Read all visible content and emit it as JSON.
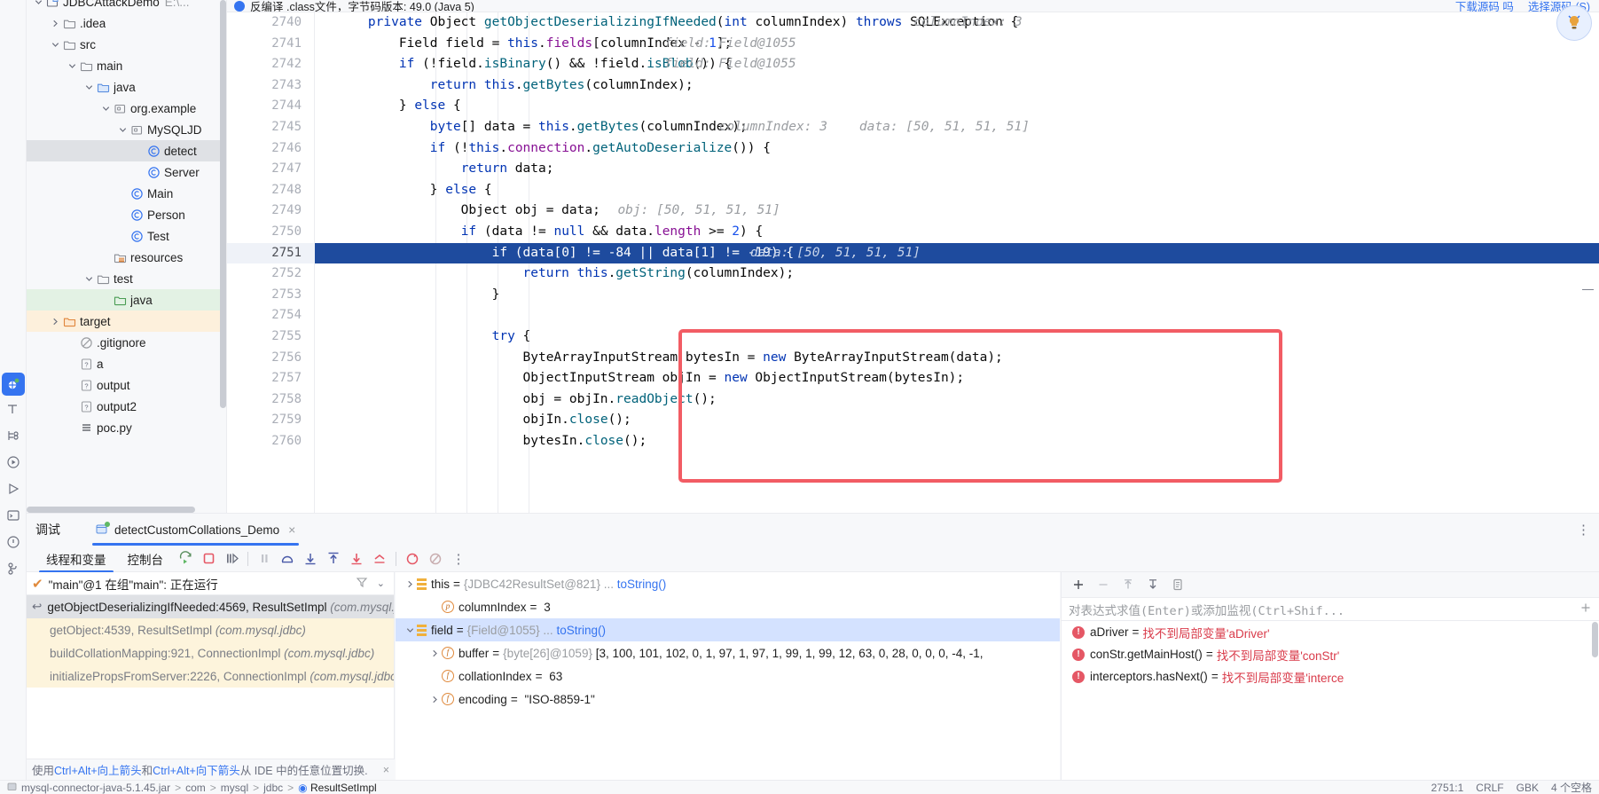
{
  "notification": {
    "text": "反编译 .class文件，字节码版本: 49.0 (Java 5)",
    "actions": [
      "下载源码 吗",
      "选择源码 (S)"
    ]
  },
  "activity_bar": {
    "items": [
      {
        "name": "debug-icon",
        "label": "Debug"
      },
      {
        "name": "build-icon",
        "label": "Build"
      },
      {
        "name": "structure-icon",
        "label": "Structure"
      },
      {
        "name": "run-icon",
        "label": "Run"
      },
      {
        "name": "play-icon",
        "label": "Run Configuration"
      },
      {
        "name": "terminal-icon",
        "label": "Terminal"
      },
      {
        "name": "problems-icon",
        "label": "Problems"
      },
      {
        "name": "git-icon",
        "label": "Git"
      }
    ]
  },
  "project_tree": {
    "items": [
      {
        "label": "JDBCAttackDemo",
        "suffix": "E:\\...",
        "indent": 0,
        "chev": "down",
        "icon": "module-icon",
        "state": "clipped"
      },
      {
        "label": ".idea",
        "indent": 1,
        "chev": "right",
        "icon": "folder-icon"
      },
      {
        "label": "src",
        "indent": 1,
        "chev": "down",
        "icon": "folder-icon"
      },
      {
        "label": "main",
        "indent": 2,
        "chev": "down",
        "icon": "folder-icon"
      },
      {
        "label": "java",
        "indent": 3,
        "chev": "down",
        "icon": "source-folder-icon"
      },
      {
        "label": "org.example",
        "indent": 4,
        "chev": "down",
        "icon": "package-icon"
      },
      {
        "label": "MySQLJD",
        "indent": 5,
        "chev": "down",
        "icon": "package-icon"
      },
      {
        "label": "detect",
        "indent": 6,
        "chev": "none",
        "icon": "class-icon",
        "state": "selected"
      },
      {
        "label": "Server",
        "indent": 6,
        "chev": "none",
        "icon": "class-icon"
      },
      {
        "label": "Main",
        "indent": 5,
        "chev": "none",
        "icon": "class-icon"
      },
      {
        "label": "Person",
        "indent": 5,
        "chev": "none",
        "icon": "class-icon"
      },
      {
        "label": "Test",
        "indent": 5,
        "chev": "none",
        "icon": "class-icon"
      },
      {
        "label": "resources",
        "indent": 4,
        "chev": "none",
        "icon": "resources-folder-icon"
      },
      {
        "label": "test",
        "indent": 3,
        "chev": "down",
        "icon": "folder-icon"
      },
      {
        "label": "java",
        "indent": 4,
        "chev": "none",
        "icon": "test-source-folder-icon",
        "state": "green"
      },
      {
        "label": "target",
        "indent": 1,
        "chev": "right",
        "icon": "excluded-folder-icon",
        "state": "orange"
      },
      {
        "label": ".gitignore",
        "indent": 2,
        "chev": "none",
        "icon": "gitignore-icon"
      },
      {
        "label": "a",
        "indent": 2,
        "chev": "none",
        "icon": "unknown-file-icon"
      },
      {
        "label": "output",
        "indent": 2,
        "chev": "none",
        "icon": "unknown-file-icon"
      },
      {
        "label": "output2",
        "indent": 2,
        "chev": "none",
        "icon": "unknown-file-icon"
      },
      {
        "label": "poc.py",
        "indent": 2,
        "chev": "none",
        "icon": "python-file-icon"
      }
    ]
  },
  "editor": {
    "lines": [
      {
        "n": 2740,
        "tokens": [
          {
            "t": "    ",
            "c": "plain"
          },
          {
            "t": "private",
            "c": "kw"
          },
          {
            "t": " ",
            "c": "plain"
          },
          {
            "t": "Object",
            "c": "plain"
          },
          {
            "t": " ",
            "c": "plain"
          },
          {
            "t": "getObjectDeserializingIfNeeded",
            "c": "mth"
          },
          {
            "t": "(",
            "c": "plain"
          },
          {
            "t": "int",
            "c": "kw"
          },
          {
            "t": " columnIndex) ",
            "c": "plain"
          },
          {
            "t": "throws",
            "c": "kw"
          },
          {
            "t": " SQLException {",
            "c": "plain"
          }
        ],
        "hints": [
          {
            "t": "columnIndex: 3",
            "col": 74
          }
        ]
      },
      {
        "n": 2741,
        "tokens": [
          {
            "t": "        Field field = ",
            "c": "plain"
          },
          {
            "t": "this",
            "c": "kw"
          },
          {
            "t": ".",
            "c": "plain"
          },
          {
            "t": "fields",
            "c": "fld"
          },
          {
            "t": "[columnIndex - ",
            "c": "plain"
          },
          {
            "t": "1",
            "c": "num"
          },
          {
            "t": "];",
            "c": "plain"
          }
        ],
        "hints": [
          {
            "t": "field: Field@1055",
            "col": 42
          }
        ]
      },
      {
        "n": 2742,
        "tokens": [
          {
            "t": "        ",
            "c": "plain"
          },
          {
            "t": "if",
            "c": "kw"
          },
          {
            "t": " (!field.",
            "c": "plain"
          },
          {
            "t": "isBinary",
            "c": "mth"
          },
          {
            "t": "() && !field.",
            "c": "plain"
          },
          {
            "t": "isBlob",
            "c": "mth"
          },
          {
            "t": "()) {",
            "c": "plain"
          }
        ],
        "hints": [
          {
            "t": "field: Field@1055",
            "col": 42
          }
        ]
      },
      {
        "n": 2743,
        "tokens": [
          {
            "t": "            ",
            "c": "plain"
          },
          {
            "t": "return",
            "c": "kw"
          },
          {
            "t": " ",
            "c": "plain"
          },
          {
            "t": "this",
            "c": "kw"
          },
          {
            "t": ".",
            "c": "plain"
          },
          {
            "t": "getBytes",
            "c": "mth"
          },
          {
            "t": "(columnIndex);",
            "c": "plain"
          }
        ],
        "hints": []
      },
      {
        "n": 2744,
        "tokens": [
          {
            "t": "        } ",
            "c": "plain"
          },
          {
            "t": "else",
            "c": "kw"
          },
          {
            "t": " {",
            "c": "plain"
          }
        ],
        "hints": []
      },
      {
        "n": 2745,
        "tokens": [
          {
            "t": "            ",
            "c": "plain"
          },
          {
            "t": "byte",
            "c": "kw"
          },
          {
            "t": "[] data = ",
            "c": "plain"
          },
          {
            "t": "this",
            "c": "kw"
          },
          {
            "t": ".",
            "c": "plain"
          },
          {
            "t": "getBytes",
            "c": "mth"
          },
          {
            "t": "(columnIndex);",
            "c": "plain"
          }
        ],
        "hints": [
          {
            "t": "columnIndex: 3",
            "col": 49
          },
          {
            "t": "data: [50, 51, 51, 51]",
            "col": 67
          }
        ]
      },
      {
        "n": 2746,
        "tokens": [
          {
            "t": "            ",
            "c": "plain"
          },
          {
            "t": "if",
            "c": "kw"
          },
          {
            "t": " (!",
            "c": "plain"
          },
          {
            "t": "this",
            "c": "kw"
          },
          {
            "t": ".",
            "c": "plain"
          },
          {
            "t": "connection",
            "c": "fld"
          },
          {
            "t": ".",
            "c": "plain"
          },
          {
            "t": "getAutoDeserialize",
            "c": "mth"
          },
          {
            "t": "()) {",
            "c": "plain"
          }
        ],
        "hints": []
      },
      {
        "n": 2747,
        "tokens": [
          {
            "t": "                ",
            "c": "plain"
          },
          {
            "t": "return",
            "c": "kw"
          },
          {
            "t": " data;",
            "c": "plain"
          }
        ],
        "hints": []
      },
      {
        "n": 2748,
        "tokens": [
          {
            "t": "            } ",
            "c": "plain"
          },
          {
            "t": "else",
            "c": "kw"
          },
          {
            "t": " {",
            "c": "plain"
          }
        ],
        "hints": []
      },
      {
        "n": 2749,
        "tokens": [
          {
            "t": "                Object obj = data;",
            "c": "plain"
          }
        ],
        "hints": [
          {
            "t": "obj: [50, 51, 51, 51]",
            "col": 36
          }
        ]
      },
      {
        "n": 2750,
        "tokens": [
          {
            "t": "                ",
            "c": "plain"
          },
          {
            "t": "if",
            "c": "kw"
          },
          {
            "t": " (data != ",
            "c": "plain"
          },
          {
            "t": "null",
            "c": "kw"
          },
          {
            "t": " && data.",
            "c": "plain"
          },
          {
            "t": "length",
            "c": "fld"
          },
          {
            "t": " >= ",
            "c": "plain"
          },
          {
            "t": "2",
            "c": "num"
          },
          {
            "t": ") {",
            "c": "plain"
          }
        ],
        "hints": []
      },
      {
        "n": 2751,
        "tokens": [
          {
            "t": "                    ",
            "c": "plain"
          },
          {
            "t": "if",
            "c": "kw"
          },
          {
            "t": " (data[",
            "c": "plain"
          },
          {
            "t": "0",
            "c": "num"
          },
          {
            "t": "] != -",
            "c": "plain"
          },
          {
            "t": "84",
            "c": "num"
          },
          {
            "t": " || data[",
            "c": "plain"
          },
          {
            "t": "1",
            "c": "num"
          },
          {
            "t": "] != -",
            "c": "plain"
          },
          {
            "t": "19",
            "c": "num"
          },
          {
            "t": ") {",
            "c": "plain"
          }
        ],
        "hints": [
          {
            "t": "data: [50, 51, 51, 51]",
            "col": 53
          }
        ],
        "highlight": true
      },
      {
        "n": 2752,
        "tokens": [
          {
            "t": "                        ",
            "c": "plain"
          },
          {
            "t": "return",
            "c": "kw"
          },
          {
            "t": " ",
            "c": "plain"
          },
          {
            "t": "this",
            "c": "kw"
          },
          {
            "t": ".",
            "c": "plain"
          },
          {
            "t": "getString",
            "c": "mth"
          },
          {
            "t": "(columnIndex);",
            "c": "plain"
          }
        ],
        "hints": []
      },
      {
        "n": 2753,
        "tokens": [
          {
            "t": "                    }",
            "c": "plain"
          }
        ],
        "hints": []
      },
      {
        "n": 2754,
        "tokens": [],
        "hints": []
      },
      {
        "n": 2755,
        "tokens": [
          {
            "t": "                    ",
            "c": "plain"
          },
          {
            "t": "try",
            "c": "kw"
          },
          {
            "t": " {",
            "c": "plain"
          }
        ],
        "hints": []
      },
      {
        "n": 2756,
        "tokens": [
          {
            "t": "                        ByteArrayInputStream bytesIn = ",
            "c": "plain"
          },
          {
            "t": "new",
            "c": "kw"
          },
          {
            "t": " ByteArrayInputStream(data);",
            "c": "plain"
          }
        ],
        "hints": []
      },
      {
        "n": 2757,
        "tokens": [
          {
            "t": "                        ObjectInputStream objIn = ",
            "c": "plain"
          },
          {
            "t": "new",
            "c": "kw"
          },
          {
            "t": " ObjectInputStream(bytesIn);",
            "c": "plain"
          }
        ],
        "hints": []
      },
      {
        "n": 2758,
        "tokens": [
          {
            "t": "                        obj = objIn.",
            "c": "plain"
          },
          {
            "t": "readObject",
            "c": "mth"
          },
          {
            "t": "();",
            "c": "plain"
          }
        ],
        "hints": []
      },
      {
        "n": 2759,
        "tokens": [
          {
            "t": "                        objIn.",
            "c": "plain"
          },
          {
            "t": "close",
            "c": "mth"
          },
          {
            "t": "();",
            "c": "plain"
          }
        ],
        "hints": []
      },
      {
        "n": 2760,
        "tokens": [
          {
            "t": "                        bytesIn.",
            "c": "plain"
          },
          {
            "t": "close",
            "c": "mth"
          },
          {
            "t": "();",
            "c": "plain"
          }
        ],
        "hints": []
      }
    ],
    "breadcrumb_clipped": "，字节码"
  },
  "debug": {
    "title": "调试",
    "session_tab": "detectCustomCollations_Demo",
    "tab_close": "×",
    "sub_tabs": [
      {
        "label": "线程和变量",
        "active": true
      },
      {
        "label": "控制台",
        "active": false
      }
    ],
    "toolbar_buttons": [
      {
        "name": "rerun-button",
        "label": "重新运行"
      },
      {
        "name": "stop-button",
        "label": "停止"
      },
      {
        "name": "resume-button",
        "label": "恢复程序"
      },
      {
        "name": "pause-button",
        "label": "暂停"
      },
      {
        "name": "step-over-button",
        "label": "跳过"
      },
      {
        "name": "step-into-button",
        "label": "步入"
      },
      {
        "name": "step-out-button",
        "label": "步出"
      },
      {
        "name": "force-step-into-button",
        "label": "强制步入"
      },
      {
        "name": "run-to-cursor-button",
        "label": "运行到光标处"
      },
      {
        "name": "view-breakpoints-button",
        "label": "查看断点"
      },
      {
        "name": "mute-breakpoints-button",
        "label": "静音断点"
      },
      {
        "name": "more-options-button",
        "label": "更多"
      }
    ],
    "thread": {
      "text": "\"main\"@1 在组\"main\": 正在运行",
      "filter_icon": "filter-icon",
      "dropdown_icon": "chevron-down-icon"
    },
    "frames": [
      {
        "text": "getObjectDeserializingIfNeeded:4569, ResultSetImpl",
        "pkg": "(com.mysql.jdbc)",
        "state": "selected",
        "has_arrow": true
      },
      {
        "text": "getObject:4539, ResultSetImpl",
        "pkg": "(com.mysql.jdbc)",
        "state": "library"
      },
      {
        "text": "buildCollationMapping:921, ConnectionImpl",
        "pkg": "(com.mysql.jdbc)",
        "state": "library"
      },
      {
        "text": "initializePropsFromServer:2226, ConnectionImpl",
        "pkg": "(com.mysql.jdbc)",
        "state": "library"
      }
    ],
    "hint_strip": {
      "prefix": "使用 ",
      "key1": "Ctrl+Alt+向上箭头",
      "mid": " 和 ",
      "key2": "Ctrl+Alt+向下箭头",
      "suffix": " 从 IDE 中的任意位置切换.",
      "close": "×"
    },
    "variables": [
      {
        "chev": "right",
        "icon": "object-icon",
        "name": "this",
        "eq": "=",
        "ref": "{JDBC42ResultSet@821}",
        "ellipsis": "...",
        "link": "toString()",
        "indent": 0
      },
      {
        "chev": "none",
        "icon": "param-icon",
        "name": "columnIndex",
        "eq": "=",
        "value": "3",
        "indent": 1
      },
      {
        "chev": "down",
        "icon": "object-icon",
        "name": "field",
        "eq": "=",
        "ref": "{Field@1055}",
        "ellipsis": "...",
        "link": "toString()",
        "indent": 0,
        "state": "selected"
      },
      {
        "chev": "right",
        "icon": "field-icon",
        "name": "buffer",
        "eq": "=",
        "ref": "{byte[26]@1059}",
        "value": "[3, 100, 101, 102, 0, 1, 97, 1, 97, 1, 99, 1, 99, 12, 63, 0, 28, 0, 0, 0, -4, -1,",
        "indent": 1
      },
      {
        "chev": "none",
        "icon": "field-icon",
        "name": "collationIndex",
        "eq": "=",
        "value": "63",
        "indent": 1
      },
      {
        "chev": "right",
        "icon": "field-icon",
        "name": "encoding",
        "eq": "=",
        "value": "\"ISO-8859-1\"",
        "indent": 1
      }
    ],
    "watch": {
      "toolbar_buttons": [
        {
          "name": "add-watch-button",
          "label": "+"
        },
        {
          "name": "remove-watch-button",
          "label": "−"
        },
        {
          "name": "move-watch-up-button",
          "label": "↑"
        },
        {
          "name": "move-watch-down-button",
          "label": "↓"
        },
        {
          "name": "copy-watch-button",
          "label": "copy-icon"
        }
      ],
      "input_placeholder": "对表达式求值(Enter)或添加监视(Ctrl+Shif...",
      "rows": [
        {
          "name": "aDriver",
          "eq": "=",
          "error": "找不到局部变量'aDriver'"
        },
        {
          "name": "conStr.getMainHost()",
          "eq": "=",
          "error": "找不到局部变量'conStr'"
        },
        {
          "name": "interceptors.hasNext()",
          "eq": "=",
          "error": "找不到局部变量'interce"
        }
      ]
    },
    "more_dots": "⋮"
  },
  "status_bar": {
    "breadcrumbs": [
      "mysql-connector-java-5.1.45.jar",
      "com",
      "mysql",
      "jdbc",
      "ResultSetImpl"
    ],
    "right": [
      "2751:1",
      "CRLF",
      "GBK",
      "4 个空格"
    ]
  }
}
